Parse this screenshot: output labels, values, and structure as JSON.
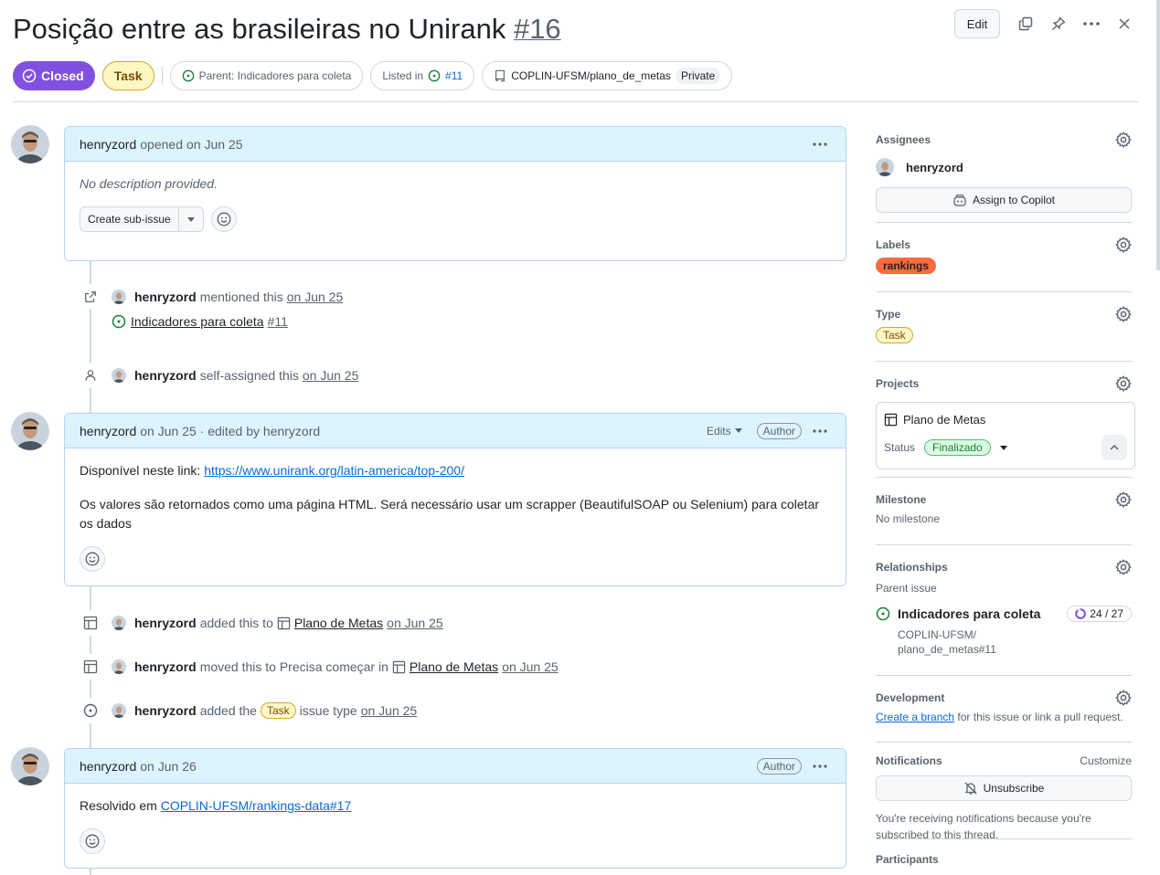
{
  "header": {
    "title": "Posição entre as brasileiras no Unirank",
    "number": "#16",
    "edit_label": "Edit",
    "state": "Closed",
    "type": "Task",
    "parent_label": "Parent: Indicadores para coleta",
    "listed_prefix": "Listed in",
    "listed_ref": "#11",
    "repo": "COPLIN-UFSM/plano_de_metas",
    "visibility": "Private"
  },
  "comment1": {
    "author": "henryzord",
    "action": "opened",
    "date": "on Jun 25",
    "body": "No description provided.",
    "sub_issue_btn": "Create sub-issue"
  },
  "events1": {
    "mention_author": "henryzord",
    "mention_text": "mentioned this",
    "mention_date": "on Jun 25",
    "mention_issue_title": "Indicadores para coleta",
    "mention_issue_num": "#11",
    "assign_author": "henryzord",
    "assign_text": "self-assigned this",
    "assign_date": "on Jun 25"
  },
  "comment2": {
    "author": "henryzord",
    "meta": "on Jun 25 · edited by henryzord",
    "edits_label": "Edits",
    "author_tag": "Author",
    "line1_prefix": "Disponível neste link:",
    "line1_link": "https://www.unirank.org/latin-america/top-200/",
    "line2": "Os valores são retornados como uma página HTML. Será necessário usar um scrapper (BeautifulSOAP ou Selenium) para coletar os dados"
  },
  "events2": {
    "added_author": "henryzord",
    "added_text": "added this to",
    "added_project": "Plano de Metas",
    "added_date": "on Jun 25",
    "moved_author": "henryzord",
    "moved_text": "moved this to Precisa começar in",
    "moved_project": "Plano de Metas",
    "moved_date": "on Jun 25",
    "type_author": "henryzord",
    "type_text1": "added the",
    "type_chip": "Task",
    "type_text2": "issue type",
    "type_date": "on Jun 25"
  },
  "comment3": {
    "author": "henryzord",
    "meta": "on Jun 26",
    "author_tag": "Author",
    "body_prefix": "Resolvido em",
    "body_link": "COPLIN-UFSM/rankings-data#17"
  },
  "sidebar": {
    "assignees_title": "Assignees",
    "assignee": "henryzord",
    "assign_copilot": "Assign to Copilot",
    "labels_title": "Labels",
    "label": "rankings",
    "type_title": "Type",
    "type_value": "Task",
    "projects_title": "Projects",
    "project_name": "Plano de Metas",
    "status_label": "Status",
    "status_value": "Finalizado",
    "milestone_title": "Milestone",
    "milestone_value": "No milestone",
    "relationships_title": "Relationships",
    "parent_issue_label": "Parent issue",
    "parent_title": "Indicadores para coleta",
    "parent_progress": "24 / 27",
    "parent_repo_line1": "COPLIN-UFSM/",
    "parent_repo_line2": "plano_de_metas#11",
    "development_title": "Development",
    "create_branch": "Create a branch",
    "development_rest": "for this issue or link a pull request.",
    "notifications_title": "Notifications",
    "customize": "Customize",
    "unsubscribe": "Unsubscribe",
    "notif_text": "You're receiving notifications because you're subscribed to this thread.",
    "participants_title": "Participants"
  },
  "colors": {
    "closed": "#8250df",
    "label_rankings": "#fb6b3c",
    "card_header": "#ddf4ff",
    "open_green": "#1a7f37"
  }
}
